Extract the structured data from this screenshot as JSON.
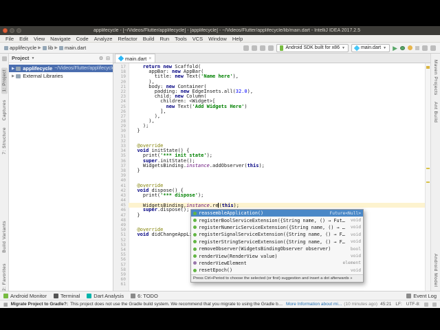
{
  "window": {
    "title": "applifecycle - [~/Videos/Flutter/applifecycle] - [applifecycle] - ~/Videos/Flutter/applifecycle/lib/main.dart - IntelliJ IDEA 2017.2.5"
  },
  "menu": {
    "items": [
      "File",
      "Edit",
      "View",
      "Navigate",
      "Code",
      "Analyze",
      "Refactor",
      "Build",
      "Run",
      "Tools",
      "VCS",
      "Window",
      "Help"
    ]
  },
  "toolbar": {
    "breadcrumb": [
      "applifecycle",
      "lib",
      "main.dart"
    ],
    "device_selector": "Android SDK built for x86",
    "run_config": "main.dart"
  },
  "left_stripe": {
    "labels": [
      "1: Project",
      "Captures",
      "7: Structure",
      "Build Variants",
      "2: Favorites"
    ]
  },
  "right_stripe": {
    "labels": [
      "Maven Projects",
      "Ant Build",
      "Android Model"
    ]
  },
  "project_panel": {
    "title": "Project",
    "items": [
      {
        "label": "applifecycle",
        "hint": "~/Videos/Flutter/applifecycle",
        "selected": true
      },
      {
        "label": "External Libraries",
        "hint": "",
        "selected": false
      }
    ]
  },
  "editor": {
    "tab": "main.dart",
    "cursor_line": 45,
    "lines": [
      {
        "n": 17,
        "seg": [
          [
            "p",
            "    "
          ],
          [
            "k",
            "return"
          ],
          [
            "p",
            " "
          ],
          [
            "k",
            "new"
          ],
          [
            "p",
            " Scaffold("
          ]
        ]
      },
      {
        "n": 18,
        "seg": [
          [
            "p",
            "      appBar: "
          ],
          [
            "k",
            "new"
          ],
          [
            "p",
            " AppBar("
          ]
        ]
      },
      {
        "n": 19,
        "seg": [
          [
            "p",
            "        title: "
          ],
          [
            "k",
            "new"
          ],
          [
            "p",
            " Text("
          ],
          [
            "s",
            "'Name here'"
          ],
          [
            "p",
            "),"
          ]
        ]
      },
      {
        "n": 20,
        "seg": [
          [
            "p",
            "      ),"
          ]
        ]
      },
      {
        "n": 21,
        "seg": [
          [
            "p",
            "      body: "
          ],
          [
            "k",
            "new"
          ],
          [
            "p",
            " Container("
          ]
        ]
      },
      {
        "n": 22,
        "seg": [
          [
            "p",
            "        padding: "
          ],
          [
            "k",
            "new"
          ],
          [
            "p",
            " EdgeInsets.all("
          ],
          [
            "n2",
            "32.0"
          ],
          [
            "p",
            "),"
          ]
        ]
      },
      {
        "n": 23,
        "seg": [
          [
            "p",
            "        child: "
          ],
          [
            "k",
            "new"
          ],
          [
            "p",
            " Column("
          ]
        ]
      },
      {
        "n": 24,
        "seg": [
          [
            "p",
            "          children: <Widget>["
          ]
        ]
      },
      {
        "n": 25,
        "seg": [
          [
            "p",
            "            "
          ],
          [
            "k",
            "new"
          ],
          [
            "p",
            " Text("
          ],
          [
            "s",
            "'Add Widgets Here'"
          ],
          [
            "p",
            ")"
          ]
        ]
      },
      {
        "n": 26,
        "seg": [
          [
            "p",
            "          ],"
          ]
        ]
      },
      {
        "n": 27,
        "seg": [
          [
            "p",
            "        ),"
          ]
        ]
      },
      {
        "n": 28,
        "seg": [
          [
            "p",
            "      ),"
          ]
        ]
      },
      {
        "n": 29,
        "seg": [
          [
            "p",
            "    );"
          ]
        ]
      },
      {
        "n": 30,
        "seg": [
          [
            "p",
            "  }"
          ]
        ]
      },
      {
        "n": 31,
        "seg": []
      },
      {
        "n": 32,
        "seg": []
      },
      {
        "n": 33,
        "seg": [
          [
            "a",
            "  @override"
          ]
        ]
      },
      {
        "n": 34,
        "seg": [
          [
            "p",
            "  "
          ],
          [
            "k",
            "void"
          ],
          [
            "p",
            " initState() {"
          ]
        ]
      },
      {
        "n": 35,
        "seg": [
          [
            "p",
            "    print("
          ],
          [
            "s",
            "'*** init state'"
          ],
          [
            "p",
            ");"
          ]
        ]
      },
      {
        "n": 36,
        "seg": [
          [
            "p",
            "    "
          ],
          [
            "k",
            "super"
          ],
          [
            "p",
            ".initState();"
          ]
        ]
      },
      {
        "n": 37,
        "seg": [
          [
            "p",
            "    WidgetsBinding."
          ],
          [
            "f",
            "instance"
          ],
          [
            "p",
            ".addObserver("
          ],
          [
            "k",
            "this"
          ],
          [
            "p",
            ");"
          ]
        ]
      },
      {
        "n": 38,
        "seg": [
          [
            "p",
            "  }"
          ]
        ]
      },
      {
        "n": 39,
        "seg": []
      },
      {
        "n": 40,
        "seg": []
      },
      {
        "n": 41,
        "seg": [
          [
            "a",
            "  @override"
          ]
        ]
      },
      {
        "n": 42,
        "seg": [
          [
            "p",
            "  "
          ],
          [
            "k",
            "void"
          ],
          [
            "p",
            " dispose() {"
          ]
        ]
      },
      {
        "n": 43,
        "seg": [
          [
            "p",
            "    print("
          ],
          [
            "s",
            "'*** dispose'"
          ],
          [
            "p",
            ");"
          ]
        ]
      },
      {
        "n": 44,
        "seg": []
      },
      {
        "n": 45,
        "seg": [
          [
            "p",
            "    WidgetsBinding."
          ],
          [
            "f",
            "instance"
          ],
          [
            "p",
            ".re"
          ],
          [
            "caret",
            ""
          ],
          [
            "p",
            "("
          ],
          [
            "k",
            "this"
          ],
          [
            "p",
            ");"
          ]
        ]
      },
      {
        "n": 46,
        "seg": [
          [
            "p",
            "    "
          ],
          [
            "k",
            "super"
          ],
          [
            "p",
            ".dispose();"
          ]
        ]
      },
      {
        "n": 47,
        "seg": [
          [
            "p",
            "  }"
          ]
        ]
      },
      {
        "n": 48,
        "seg": []
      },
      {
        "n": 49,
        "seg": []
      },
      {
        "n": 50,
        "seg": [
          [
            "a",
            "  @override"
          ]
        ]
      },
      {
        "n": 51,
        "seg": [
          [
            "p",
            "  "
          ],
          [
            "k",
            "void"
          ],
          [
            "p",
            " didChangeAppLifecycleState(AppLifecycleState state) {"
          ]
        ]
      },
      {
        "n": 52,
        "seg": []
      },
      {
        "n": 53,
        "seg": []
      },
      {
        "n": 54,
        "seg": []
      },
      {
        "n": 55,
        "seg": []
      },
      {
        "n": 56,
        "seg": []
      },
      {
        "n": 57,
        "seg": []
      },
      {
        "n": 58,
        "seg": []
      },
      {
        "n": 59,
        "seg": []
      },
      {
        "n": 60,
        "seg": []
      },
      {
        "n": 61,
        "seg": []
      }
    ]
  },
  "completion": {
    "items": [
      {
        "label": "reassembleApplication()",
        "type": "Future<Null>",
        "kind": "method",
        "selected": true
      },
      {
        "label": "registerBoolServiceExtension({String name, () → Future<bo…",
        "type": "void",
        "kind": "method",
        "selected": false
      },
      {
        "label": "registerNumericServiceExtension({String name, () → Futur…",
        "type": "void",
        "kind": "method",
        "selected": false
      },
      {
        "label": "registerSignalServiceExtension({String name, () → Future<…",
        "type": "void",
        "kind": "method",
        "selected": false
      },
      {
        "label": "registerStringServiceExtension({String name, () → Future…",
        "type": "void",
        "kind": "method",
        "selected": false
      },
      {
        "label": "removeObserver(WidgetsBindingObserver observer)",
        "type": "bool",
        "kind": "method",
        "selected": false
      },
      {
        "label": "renderView(RenderView value)",
        "type": "void",
        "kind": "method",
        "selected": false
      },
      {
        "label": "renderViewElement",
        "type": "element",
        "kind": "field",
        "selected": false
      },
      {
        "label": "resetEpoch()",
        "type": "void",
        "kind": "method",
        "selected": false
      }
    ],
    "hint": "Press Ctrl+Period to choose the selected (or first) suggestion and insert a dot afterwards »"
  },
  "tool_buttons": {
    "left": [
      {
        "label": "Android Monitor",
        "icon": "android-icon",
        "color": "#77bb41"
      },
      {
        "label": "Terminal",
        "icon": "terminal-icon",
        "color": "#555555"
      },
      {
        "label": "Dart Analysis",
        "icon": "dart-icon",
        "color": "#00b4ab"
      },
      {
        "label": "6: TODO",
        "icon": "todo-icon",
        "color": "#8a8a8a"
      }
    ],
    "right": [
      {
        "label": "Event Log",
        "icon": "event-log-icon",
        "color": "#8a8a8a"
      }
    ]
  },
  "status_bar": {
    "message_title": "Migrate Project to Gradle?:",
    "message_body": "This project does not use the Gradle build system. We recommend that you migrate to using the Gradle build system. /",
    "message_link": "More Information about mi...",
    "message_time": "(10 minutes ago)",
    "cursor_position": "45:21",
    "line_separator": "LF:",
    "encoding": "UTF-8:"
  }
}
